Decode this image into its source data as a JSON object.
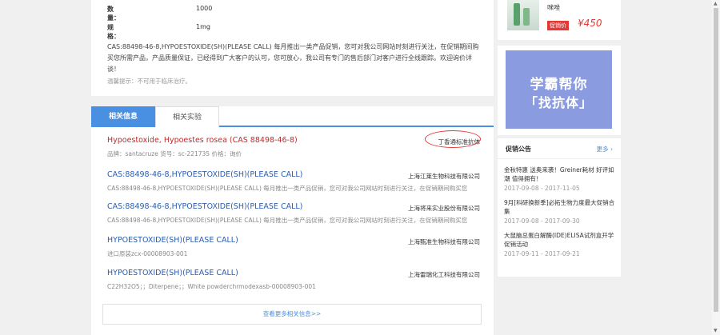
{
  "specs": {
    "qty_label": "数量：",
    "qty_value": "1000",
    "size_label": "规格：",
    "size_value": "1mg"
  },
  "description": "CAS:88498-46-8,HYPOESTOXIDE(SH)(PLEASE CALL) 每月推出一类产品促销，您可对我公司网站时刻进行关注，在促销期间购买您所需产品，产品质量保证，已经得到广大客户的认可，您可放心，我公司有专门的售后部门对客户进行全线跟踪。欢迎询价详谈！",
  "tip": "温馨提示：不可用于临床治疗。",
  "tabs": {
    "active": "相关信息",
    "other": "相关实验"
  },
  "related": [
    {
      "title": "Hypoestoxide, Hypoestes rosea",
      "cas": "(CAS 88498-46-8)",
      "sub": "品牌：santacruze   货号：sc-221735   价格：询价",
      "vendor": "丁香通标准抗体"
    },
    {
      "title": "CAS:88498-46-8,HYPOESTOXIDE(SH)(PLEASE CALL)",
      "sub": "CAS:88498-46-8,HYPOESTOXIDE(SH)(PLEASE CALL) 每月推出一类产品促销，您可对我公司网站时刻进行关注，在促销期间购买您",
      "vendor": "上海江莱生物科技有限公司"
    },
    {
      "title": "CAS:88498-46-8,HYPOESTOXIDE(SH)(PLEASE CALL)",
      "sub": "CAS:88498-46-8,HYPOESTOXIDE(SH)(PLEASE CALL) 每月推出一类产品促销，您可对我公司网站时刻进行关注，在促销期间购买您",
      "vendor": "上海将来实业股份有限公司"
    },
    {
      "title": "HYPOESTOXIDE(SH)(PLEASE CALL)",
      "sub": "进口原装zcx-00008903-001",
      "vendor": "上海甄准生物科技有限公司"
    },
    {
      "title": "HYPOESTOXIDE(SH)(PLEASE CALL)",
      "sub": "C22H32O5；；Diterpene；；White powderchrmodexasb-00008903-001",
      "vendor": "上海雷瑞化工科技有限公司"
    }
  ],
  "more_link": "查看更多相关信息>>",
  "side_product": {
    "name": "咪唑",
    "tag": "促销价",
    "price": "¥450"
  },
  "banner": {
    "line1": "学霸帮你",
    "line2": "「找抗体」"
  },
  "promo": {
    "title": "促销公告",
    "more": "更多 ›",
    "items": [
      {
        "text": "金秋特惠 送奥来袭！Greiner耗材 好评如潮 值得拥有！",
        "date": "2017-09-08 - 2017-11-05"
      },
      {
        "text": "9月[科研换新季]必拓生物力度最大促销合集",
        "date": "2017-09-08 - 2017-09-30"
      },
      {
        "text": "大鼠脑总蛋白解酶(IDE)ELISA试剂盒开学促销活动",
        "date": "2017-09-11 - 2017-09-21"
      }
    ]
  },
  "colors": {
    "accent": "#4a90e2",
    "price_red": "#e53935",
    "link_blue": "#2a5db0"
  }
}
